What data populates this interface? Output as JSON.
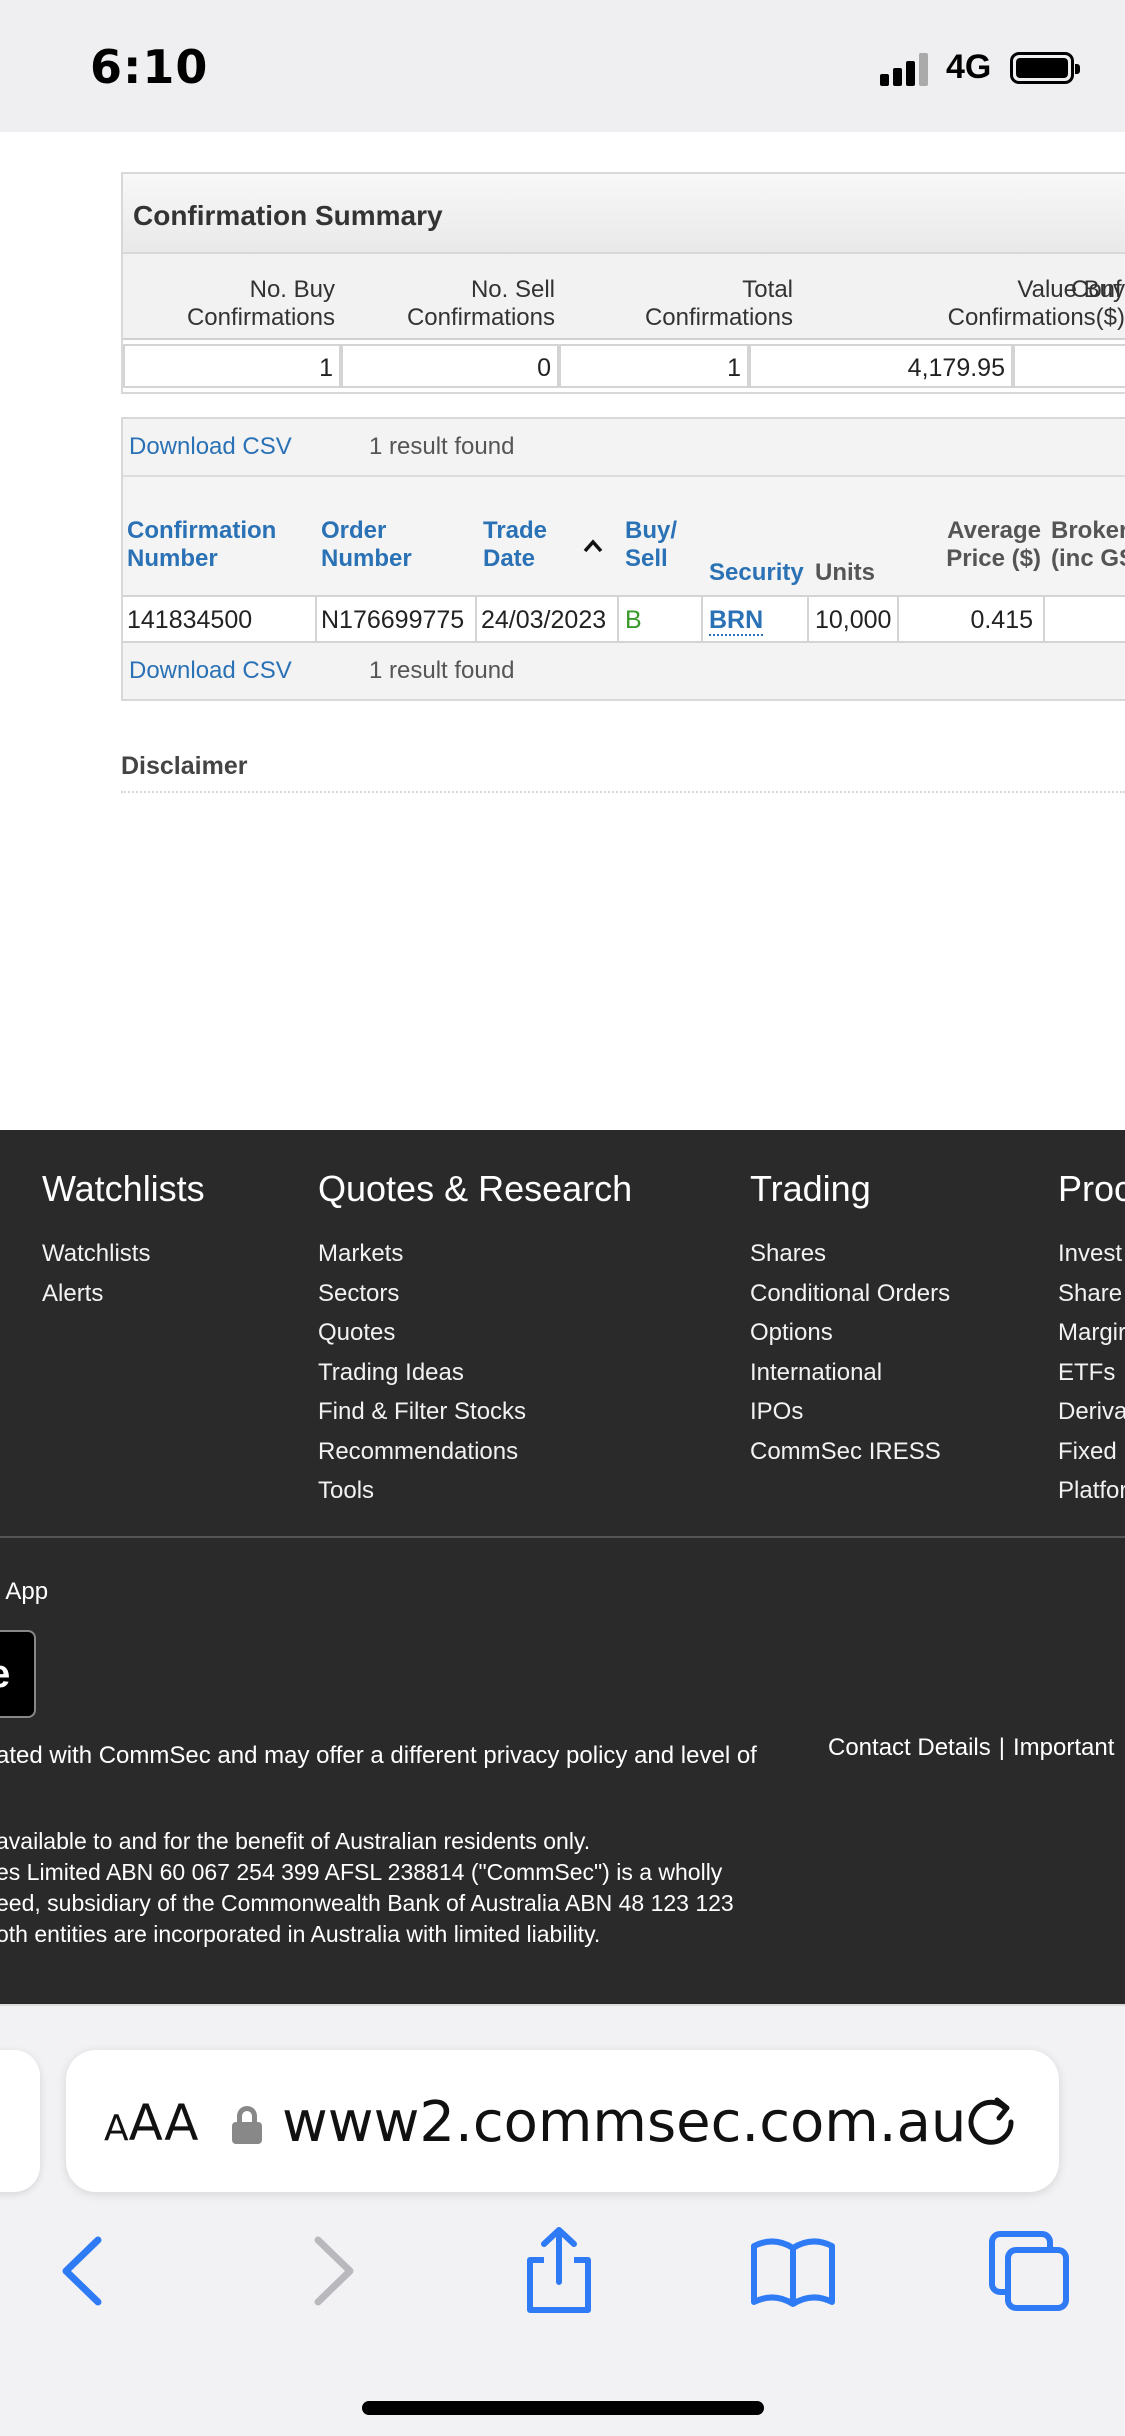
{
  "status_bar": {
    "time": "6:10",
    "network": "4G"
  },
  "summary": {
    "title": "Confirmation Summary",
    "headers": [
      [
        "No. Buy",
        "Confirmations"
      ],
      [
        "No. Sell",
        "Confirmations"
      ],
      [
        "Total",
        "Confirmations"
      ],
      [
        "Value Buy",
        "Confirmations($)"
      ],
      [
        "",
        "Conf"
      ]
    ],
    "values": [
      "1",
      "0",
      "1",
      "4,179.95",
      ""
    ]
  },
  "results": {
    "download_csv": "Download CSV",
    "result_count": "1 result found",
    "columns": {
      "conf_number": [
        "Confirmation",
        "Number"
      ],
      "order_number": [
        "Order",
        "Number"
      ],
      "trade_date": [
        "Trade",
        "Date"
      ],
      "buy_sell": [
        "Buy/",
        "Sell"
      ],
      "security": "Security",
      "units": "Units",
      "avg_price": [
        "Average",
        "Price ($)"
      ],
      "brokerage": [
        "Broker",
        "(inc GS"
      ]
    },
    "row": {
      "conf_number": "141834500",
      "order_number": "N176699775",
      "trade_date": "24/03/2023",
      "buy_sell": "B",
      "security": "BRN",
      "units": "10,000",
      "avg_price": "0.415"
    }
  },
  "disclaimer": "Disclaimer",
  "footer": {
    "columns": [
      {
        "title": "Watchlists",
        "links": [
          "Watchlists",
          "Alerts"
        ]
      },
      {
        "title": "Quotes & Research",
        "links": [
          "Markets",
          "Sectors",
          "Quotes",
          "Trading Ideas",
          "Find & Filter Stocks",
          "Recommendations",
          "Tools"
        ]
      },
      {
        "title": "Trading",
        "links": [
          "Shares",
          "Conditional Orders",
          "Options",
          "International",
          "IPOs",
          "CommSec IRESS"
        ]
      },
      {
        "title": "Proc",
        "links": [
          "Invest",
          "Share",
          "Margir",
          "ETFs",
          "Deriva",
          "Fixed",
          "Platfor"
        ]
      }
    ],
    "app_label": "c App",
    "privacy_text": "ated with CommSec and may offer a different privacy policy and level of",
    "links": [
      "Contact Details",
      "Important"
    ],
    "link_separator": "|",
    "legal": [
      "available to and for the benefit of Australian residents only.",
      "es Limited ABN 60 067 254 399 AFSL 238814 (\"CommSec\") is a wholly",
      "eed, subsidiary of the Commonwealth Bank of Australia ABN 48 123 123",
      "oth entities are incorporated in Australia with limited liability."
    ]
  },
  "browser": {
    "aa_label": "AA",
    "url": "www2.commsec.com.au",
    "accent_color": "#2f7bf5"
  }
}
